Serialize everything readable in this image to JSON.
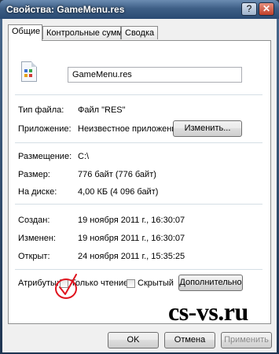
{
  "window": {
    "title": "Свойства: GameMenu.res",
    "help_glyph": "?",
    "close_glyph": "✕"
  },
  "tabs": [
    {
      "label": "Общие",
      "active": true
    },
    {
      "label": "Контрольные суммы",
      "active": false
    },
    {
      "label": "Сводка",
      "active": false
    }
  ],
  "file": {
    "name": "GameMenu.res",
    "icon": "generic-file-icon"
  },
  "props": {
    "type_label": "Тип файла:",
    "type_value": "Файл \"RES\"",
    "app_label": "Приложение:",
    "app_value": "Неизвестное приложение",
    "change_button": "Изменить...",
    "location_label": "Размещение:",
    "location_value": "C:\\",
    "size_label": "Размер:",
    "size_value": "776 байт (776 байт)",
    "disk_label": "На диске:",
    "disk_value": "4,00 КБ (4 096 байт)",
    "created_label": "Создан:",
    "created_value": "19 ноября 2011 г., 16:30:07",
    "modified_label": "Изменен:",
    "modified_value": "19 ноября 2011 г., 16:30:07",
    "opened_label": "Открыт:",
    "opened_value": "24 ноября 2011 г., 15:35:25"
  },
  "attributes": {
    "label": "Атрибуты:",
    "readonly_label": "Только чтение",
    "readonly_checked": false,
    "hidden_label": "Скрытый",
    "hidden_checked": false,
    "advanced_button": "Дополнительно"
  },
  "footer": {
    "ok": "OK",
    "cancel": "Отмена",
    "apply": "Применить"
  },
  "annotation": {
    "color": "#e0141e"
  },
  "watermark": "cs-vs.ru"
}
